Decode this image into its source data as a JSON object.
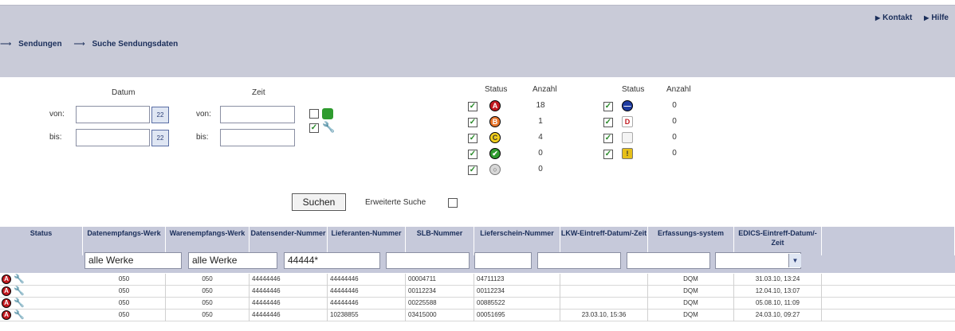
{
  "header": {
    "links": [
      "Kontakt",
      "Hilfe"
    ],
    "breadcrumb": [
      "Sendungen",
      "Suche Sendungsdaten"
    ]
  },
  "filter": {
    "datum_label": "Datum",
    "zeit_label": "Zeit",
    "von_label": "von:",
    "bis_label": "bis:",
    "calendar_icon_text": "22",
    "status_label": "Status",
    "anzahl_label": "Anzahl",
    "status_left": [
      {
        "icon": "A",
        "color": "#c2191f",
        "count": "18"
      },
      {
        "icon": "B",
        "color": "#e7742b",
        "count": "1"
      },
      {
        "icon": "C",
        "color": "#f2cf1d",
        "count": "4"
      },
      {
        "icon": "✔",
        "color": "#2e9b2e",
        "count": "0"
      },
      {
        "icon": "○",
        "color": "#9a9a9a",
        "count": "0"
      }
    ],
    "status_right": [
      {
        "icon": "—",
        "color": "#1e3ba0",
        "count": "0"
      },
      {
        "icon": "D",
        "color": "#c2191f",
        "count": "0"
      },
      {
        "icon": "",
        "color": "#cfcfcf",
        "count": "0"
      },
      {
        "icon": "!",
        "color": "#e6c01a",
        "count": "0"
      }
    ],
    "search_button": "Suchen",
    "extended_search_label": "Erweiterte Suche"
  },
  "table": {
    "columns": [
      "Status",
      "Datenempfangs-Werk",
      "Warenempfangs-Werk",
      "Datensender-Nummer",
      "Lieferanten-Nummer",
      "SLB-Nummer",
      "Lieferschein-Nummer",
      "LKW-Eintreff-Datum/-Zeit",
      "Erfassungs-system",
      "EDICS-Eintreff-Datum/-Zeit"
    ],
    "filters": [
      "alle Werke",
      "alle Werke",
      "44444*",
      "",
      "",
      "",
      "",
      ""
    ],
    "rows": [
      [
        "050",
        "050",
        "44444446",
        "44444446",
        "00004711",
        "04711123",
        "",
        "DQM",
        "31.03.10, 13:24"
      ],
      [
        "050",
        "050",
        "44444446",
        "44444446",
        "00112234",
        "00112234",
        "",
        "DQM",
        "12.04.10, 13:07"
      ],
      [
        "050",
        "050",
        "44444446",
        "44444446",
        "00225588",
        "00885522",
        "",
        "DQM",
        "05.08.10, 11:09"
      ],
      [
        "050",
        "050",
        "44444446",
        "10238855",
        "03415000",
        "00051695",
        "23.03.10, 15:36",
        "DQM",
        "24.03.10, 09:27"
      ]
    ]
  },
  "colors": {
    "header_bg": "#c9cbd8",
    "table_header_bg": "#c6c9da",
    "text_blue": "#1a2e5a"
  }
}
